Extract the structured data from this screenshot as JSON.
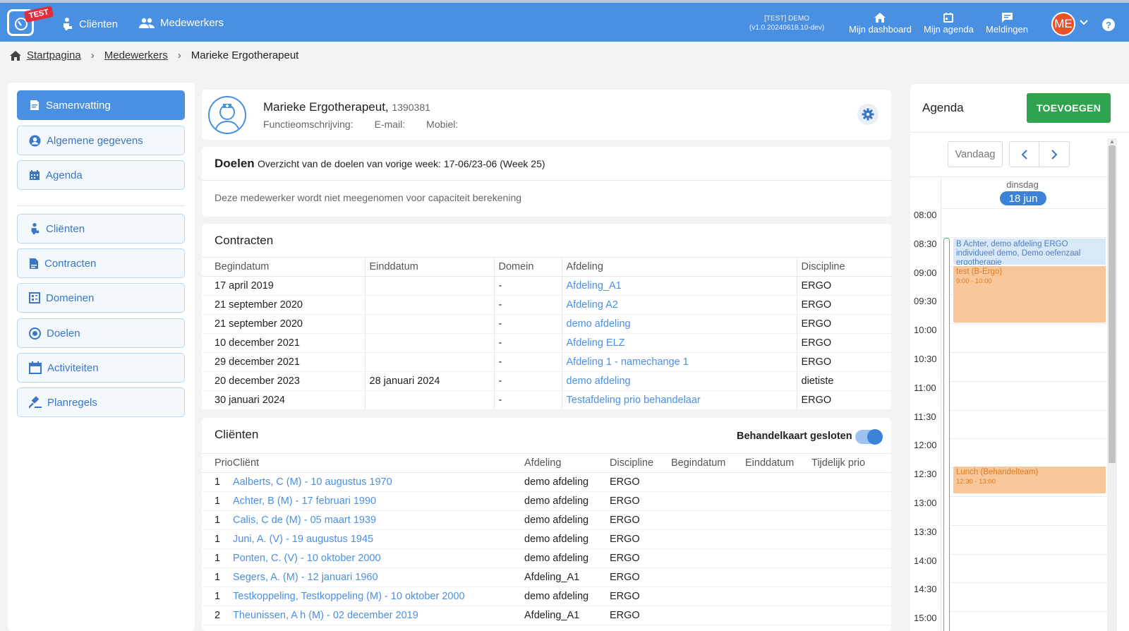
{
  "topbar": {
    "badge": "TEST",
    "nav": [
      {
        "label": "Cliënten",
        "icon": "person-icon"
      },
      {
        "label": "Medewerkers",
        "icon": "people-icon"
      }
    ],
    "version_line1": "[TEST] DEMO",
    "version_line2": "(v1.0.20240618.10-dev)",
    "links": [
      {
        "label": "Mijn dashboard",
        "icon": "home-icon"
      },
      {
        "label": "Mijn agenda",
        "icon": "calendar-icon"
      },
      {
        "label": "Meldingen",
        "icon": "chat-icon"
      }
    ],
    "avatar_initials": "ME",
    "help": "?"
  },
  "breadcrumb": {
    "home": "Startpagina",
    "parent": "Medewerkers",
    "current": "Marieke Ergotherapeut"
  },
  "sidebar": {
    "items": [
      {
        "label": "Samenvatting",
        "icon": "document-icon",
        "active": true
      },
      {
        "label": "Algemene gegevens",
        "icon": "account-icon"
      },
      {
        "label": "Agenda",
        "icon": "calendar-icon"
      },
      {
        "label": "Cliënten",
        "icon": "person-icon"
      },
      {
        "label": "Contracten",
        "icon": "contract-icon"
      },
      {
        "label": "Domeinen",
        "icon": "domains-icon"
      },
      {
        "label": "Doelen",
        "icon": "target-icon"
      },
      {
        "label": "Activiteiten",
        "icon": "calendar-blank-icon"
      },
      {
        "label": "Planregels",
        "icon": "gavel-icon"
      }
    ]
  },
  "profile": {
    "name": "Marieke Ergotherapeut,",
    "id": "1390381",
    "function_label": "Functieomschrijving:",
    "email_label": "E-mail:",
    "mobile_label": "Mobiel:"
  },
  "doelen": {
    "title": "Doelen",
    "subtitle": "Overzicht van de doelen van vorige week: 17-06/23-06 (Week 25)",
    "note": "Deze medewerker wordt niet meegenomen voor capaciteit berekening"
  },
  "contracten": {
    "title": "Contracten",
    "headers": [
      "Begindatum",
      "Einddatum",
      "Domein",
      "Afdeling",
      "Discipline"
    ],
    "rows": [
      [
        "17 april 2019",
        "",
        "-",
        "Afdeling_A1",
        "ERGO"
      ],
      [
        "21 september 2020",
        "",
        "-",
        "Afdeling A2",
        "ERGO"
      ],
      [
        "21 september 2020",
        "",
        "-",
        "demo afdeling",
        "ERGO"
      ],
      [
        "10 december 2021",
        "",
        "-",
        "Afdeling ELZ",
        "ERGO"
      ],
      [
        "29 december 2021",
        "",
        "-",
        "Afdeling 1 - namechange 1",
        "ERGO"
      ],
      [
        "20 december 2023",
        "28 januari 2024",
        "-",
        "demo afdeling",
        "dietiste"
      ],
      [
        "30 januari 2024",
        "",
        "-",
        "Testafdeling prio behandelaar",
        "ERGO"
      ]
    ]
  },
  "clienten": {
    "title": "Cliënten",
    "toggle_label": "Behandelkaart gesloten",
    "toggle_on": true,
    "headers": [
      "Prio",
      "Cliënt",
      "Afdeling",
      "Discipline",
      "Begindatum",
      "Einddatum",
      "Tijdelijk prio"
    ],
    "rows": [
      [
        "1",
        "Aalberts, C (M) - 10 augustus 1970",
        "demo afdeling",
        "ERGO",
        "",
        "",
        ""
      ],
      [
        "1",
        "Achter, B (M) - 17 februari 1990",
        "demo afdeling",
        "ERGO",
        "",
        "",
        ""
      ],
      [
        "1",
        "Calis, C de (M) - 05 maart 1939",
        "demo afdeling",
        "ERGO",
        "",
        "",
        ""
      ],
      [
        "1",
        "Juni, A. (V) - 19 augustus 1945",
        "demo afdeling",
        "ERGO",
        "",
        "",
        ""
      ],
      [
        "1",
        "Ponten, C. (V) - 10 oktober 2000",
        "demo afdeling",
        "ERGO",
        "",
        "",
        ""
      ],
      [
        "1",
        "Segers, A. (M) - 12 januari 1960",
        "Afdeling_A1",
        "ERGO",
        "",
        "",
        ""
      ],
      [
        "1",
        "Testkoppeling, Testkoppeling (M) - 10 oktober 2000",
        "demo afdeling",
        "ERGO",
        "",
        "",
        ""
      ],
      [
        "2",
        "Theunissen, A h (M) - 02 december 2019",
        "Afdeling_A1",
        "ERGO",
        "",
        "",
        ""
      ]
    ]
  },
  "agenda": {
    "title": "Agenda",
    "add_label": "TOEVOEGEN",
    "today_label": "Vandaag",
    "day_name": "dinsdag",
    "day_date": "18 jun",
    "times": [
      "08:00",
      "08:30",
      "09:00",
      "09:30",
      "10:00",
      "10:30",
      "11:00",
      "11:30",
      "12:00",
      "12:30",
      "13:00",
      "13:30",
      "14:00",
      "14:30",
      "15:00"
    ],
    "events": [
      {
        "title": "B Achter, demo afdeling ERGO individueel demo, Demo oefenzaal ergotherapie",
        "time": "",
        "color": "blue"
      },
      {
        "title": "test (B-Ergo)",
        "time": "9:00 - 10:00",
        "color": "orange"
      },
      {
        "title": "Lunch (Behandelteam)",
        "time": "12:30 - 13:00",
        "color": "orange"
      }
    ]
  },
  "colors": {
    "primary": "#4a90e2",
    "success": "#2ea44f",
    "avatar": "#e8512a",
    "badge": "#e02e3e",
    "event_blue": "#d9e8f8",
    "event_orange": "#f7c79a"
  }
}
